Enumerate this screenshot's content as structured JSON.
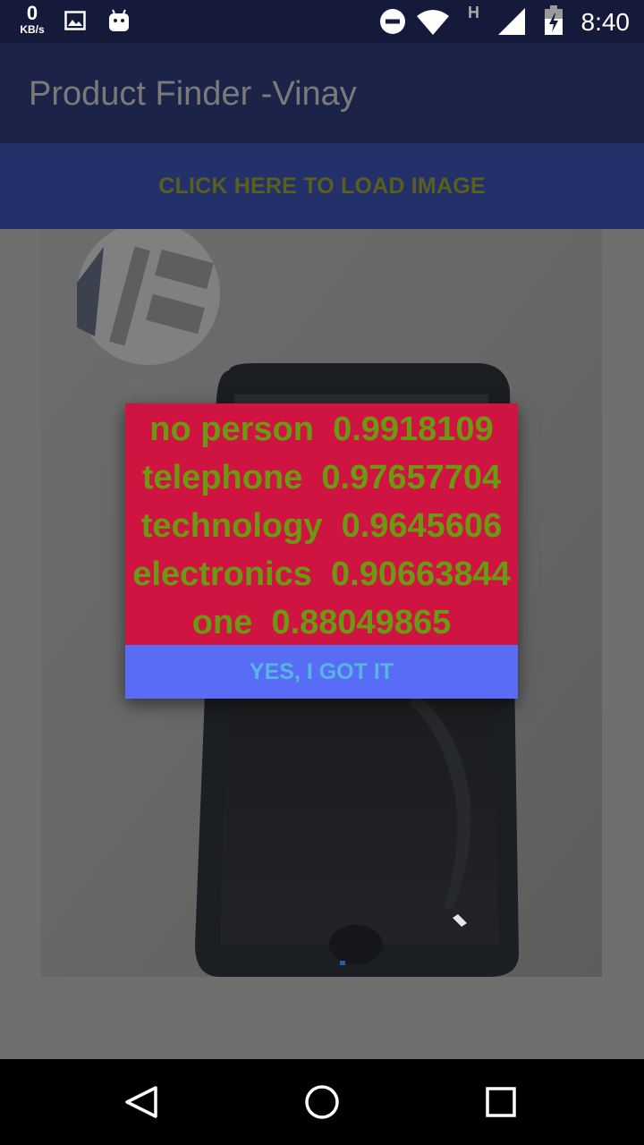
{
  "status_bar": {
    "net_speed": "0",
    "net_unit": "KB/s",
    "network_type": "H",
    "time": "8:40",
    "icons": [
      "image-icon",
      "android-icon",
      "do-not-disturb-icon",
      "wifi-icon",
      "signal-icon",
      "battery-icon"
    ]
  },
  "app_bar": {
    "title": "Product Finder -Vinay"
  },
  "load_button": {
    "label": "CLICK HERE TO LOAD IMAGE"
  },
  "dialog": {
    "results": [
      "no person  0.9918109",
      "telephone  0.97657704",
      "technology  0.9645606",
      "electronics  0.90663844",
      "one  0.88049865"
    ],
    "button_label": "YES, I GOT IT"
  },
  "nav_bar": {
    "icons": [
      "back-icon",
      "home-icon",
      "recents-icon"
    ]
  },
  "colors": {
    "status_bar": "#151a3a",
    "app_bar": "#1c2348",
    "load_button_bg": "#233069",
    "dialog_body": "#cf1441",
    "dialog_text": "#6b9a12",
    "dialog_button": "#586cf6"
  }
}
